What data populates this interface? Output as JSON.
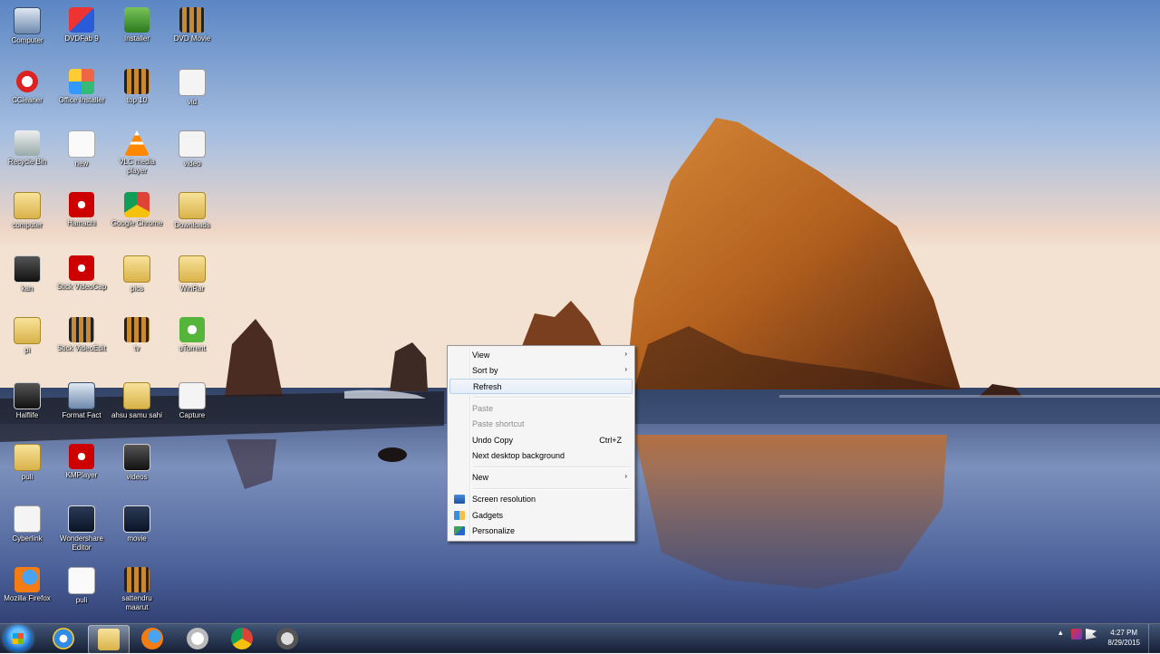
{
  "desktop": {
    "icons": [
      {
        "label": "Computer"
      },
      {
        "label": "DVDFab 9"
      },
      {
        "label": "Installer"
      },
      {
        "label": "DVD Movie"
      },
      {
        "label": "CCleaner"
      },
      {
        "label": "Office Installer"
      },
      {
        "label": "top 10"
      },
      {
        "label": "vid"
      },
      {
        "label": "Recycle Bin"
      },
      {
        "label": "new"
      },
      {
        "label": "VLC media player"
      },
      {
        "label": "video"
      },
      {
        "label": "computer"
      },
      {
        "label": "Hamachi"
      },
      {
        "label": "Google Chrome"
      },
      {
        "label": "Downloads"
      },
      {
        "label": "kan"
      },
      {
        "label": "Stick VideoCap"
      },
      {
        "label": "pics"
      },
      {
        "label": "WinRar"
      },
      {
        "label": "pi"
      },
      {
        "label": "Stick VideoEdit"
      },
      {
        "label": "tv"
      },
      {
        "label": "uTorrent"
      },
      {
        "label": "Halflife"
      },
      {
        "label": "Format Fact"
      },
      {
        "label": "ahsu samu sahi"
      },
      {
        "label": "Capture"
      },
      {
        "label": "puli"
      },
      {
        "label": "KMPlayer"
      },
      {
        "label": "videos"
      },
      {
        "label": "Cyberlink"
      },
      {
        "label": "Wondershare Editor"
      },
      {
        "label": "movie"
      },
      {
        "label": "Mozilla Firefox"
      },
      {
        "label": "puli"
      },
      {
        "label": "sattendru maarut"
      }
    ]
  },
  "context_menu": {
    "items": {
      "view": "View",
      "sort_by": "Sort by",
      "refresh": "Refresh",
      "paste": "Paste",
      "paste_shortcut": "Paste shortcut",
      "undo_copy": "Undo Copy",
      "undo_copy_shortcut": "Ctrl+Z",
      "next_background": "Next desktop background",
      "new": "New",
      "screen_resolution": "Screen resolution",
      "gadgets": "Gadgets",
      "personalize": "Personalize"
    },
    "submenu_arrow": "›"
  },
  "taskbar": {
    "pinned": [
      "start-orb",
      "internet-explorer-icon",
      "file-explorer-icon",
      "firefox-icon",
      "messenger-icon",
      "chrome-icon",
      "media-icon"
    ],
    "clock": {
      "time": "4:27 PM",
      "date": "8/29/2015"
    }
  }
}
